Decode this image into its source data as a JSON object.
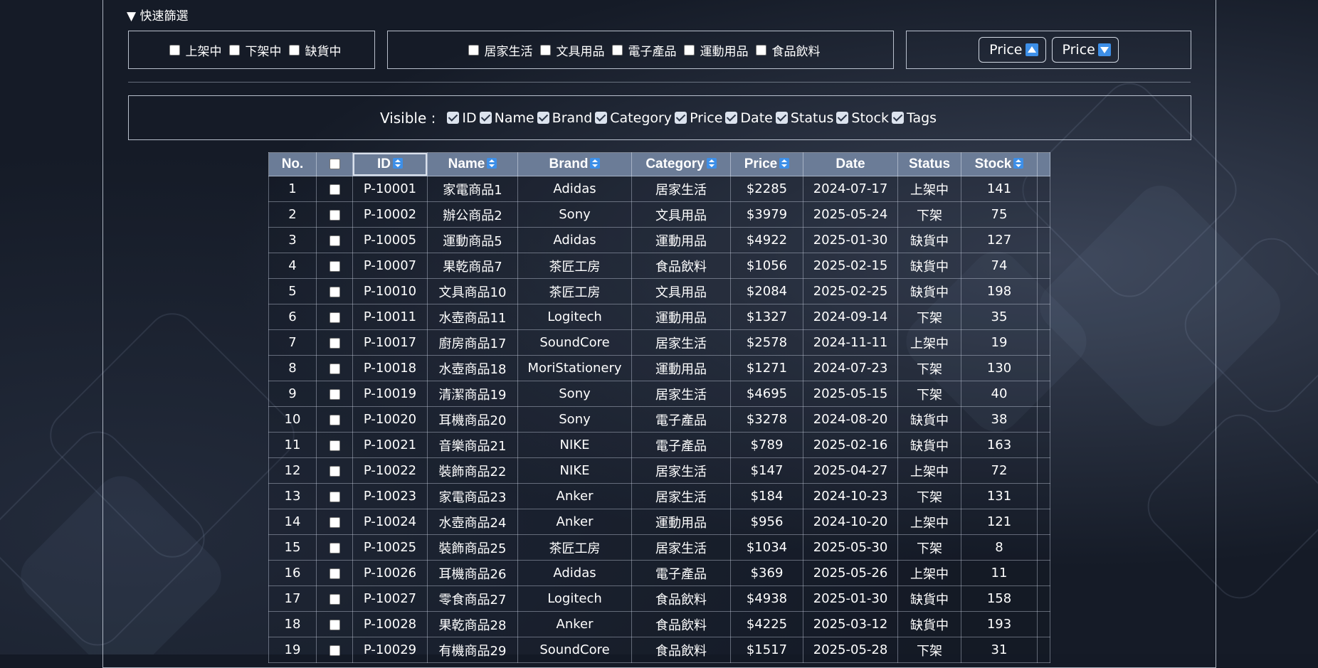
{
  "filters": {
    "toggle_label": "▼ 快速篩選",
    "status_options": [
      "上架中",
      "下架中",
      "缺貨中"
    ],
    "category_options": [
      "居家生活",
      "文具用品",
      "電子產品",
      "運動用品",
      "食品飲料"
    ],
    "sort_buttons": [
      {
        "label": "Price",
        "icon": "arrow-up-icon"
      },
      {
        "label": "Price",
        "icon": "arrow-down-icon"
      }
    ]
  },
  "visibility": {
    "label": "Visible :",
    "columns": [
      "ID",
      "Name",
      "Brand",
      "Category",
      "Price",
      "Date",
      "Status",
      "Stock",
      "Tags"
    ]
  },
  "table": {
    "headers": {
      "no": "No.",
      "id": "ID",
      "name": "Name",
      "brand": "Brand",
      "category": "Category",
      "price": "Price",
      "date": "Date",
      "status": "Status",
      "stock": "Stock"
    },
    "rows": [
      {
        "no": "1",
        "id": "P-10001",
        "name": "家電商品1",
        "brand": "Adidas",
        "category": "居家生活",
        "price": "$2285",
        "date": "2024-07-17",
        "status": "上架中",
        "stock": "141"
      },
      {
        "no": "2",
        "id": "P-10002",
        "name": "辦公商品2",
        "brand": "Sony",
        "category": "文具用品",
        "price": "$3979",
        "date": "2025-05-24",
        "status": "下架",
        "stock": "75"
      },
      {
        "no": "3",
        "id": "P-10005",
        "name": "運動商品5",
        "brand": "Adidas",
        "category": "運動用品",
        "price": "$4922",
        "date": "2025-01-30",
        "status": "缺貨中",
        "stock": "127"
      },
      {
        "no": "4",
        "id": "P-10007",
        "name": "果乾商品7",
        "brand": "茶匠工房",
        "category": "食品飲料",
        "price": "$1056",
        "date": "2025-02-15",
        "status": "缺貨中",
        "stock": "74"
      },
      {
        "no": "5",
        "id": "P-10010",
        "name": "文具商品10",
        "brand": "茶匠工房",
        "category": "文具用品",
        "price": "$2084",
        "date": "2025-02-25",
        "status": "缺貨中",
        "stock": "198"
      },
      {
        "no": "6",
        "id": "P-10011",
        "name": "水壺商品11",
        "brand": "Logitech",
        "category": "運動用品",
        "price": "$1327",
        "date": "2024-09-14",
        "status": "下架",
        "stock": "35"
      },
      {
        "no": "7",
        "id": "P-10017",
        "name": "廚房商品17",
        "brand": "SoundCore",
        "category": "居家生活",
        "price": "$2578",
        "date": "2024-11-11",
        "status": "上架中",
        "stock": "19"
      },
      {
        "no": "8",
        "id": "P-10018",
        "name": "水壺商品18",
        "brand": "MoriStationery",
        "category": "運動用品",
        "price": "$1271",
        "date": "2024-07-23",
        "status": "下架",
        "stock": "130"
      },
      {
        "no": "9",
        "id": "P-10019",
        "name": "清潔商品19",
        "brand": "Sony",
        "category": "居家生活",
        "price": "$4695",
        "date": "2025-05-15",
        "status": "下架",
        "stock": "40"
      },
      {
        "no": "10",
        "id": "P-10020",
        "name": "耳機商品20",
        "brand": "Sony",
        "category": "電子產品",
        "price": "$3278",
        "date": "2024-08-20",
        "status": "缺貨中",
        "stock": "38"
      },
      {
        "no": "11",
        "id": "P-10021",
        "name": "音樂商品21",
        "brand": "NIKE",
        "category": "電子產品",
        "price": "$789",
        "date": "2025-02-16",
        "status": "缺貨中",
        "stock": "163"
      },
      {
        "no": "12",
        "id": "P-10022",
        "name": "裝飾商品22",
        "brand": "NIKE",
        "category": "居家生活",
        "price": "$147",
        "date": "2025-04-27",
        "status": "上架中",
        "stock": "72"
      },
      {
        "no": "13",
        "id": "P-10023",
        "name": "家電商品23",
        "brand": "Anker",
        "category": "居家生活",
        "price": "$184",
        "date": "2024-10-23",
        "status": "下架",
        "stock": "131"
      },
      {
        "no": "14",
        "id": "P-10024",
        "name": "水壺商品24",
        "brand": "Anker",
        "category": "運動用品",
        "price": "$956",
        "date": "2024-10-20",
        "status": "上架中",
        "stock": "121"
      },
      {
        "no": "15",
        "id": "P-10025",
        "name": "裝飾商品25",
        "brand": "茶匠工房",
        "category": "居家生活",
        "price": "$1034",
        "date": "2025-05-30",
        "status": "下架",
        "stock": "8"
      },
      {
        "no": "16",
        "id": "P-10026",
        "name": "耳機商品26",
        "brand": "Adidas",
        "category": "電子產品",
        "price": "$369",
        "date": "2025-05-26",
        "status": "上架中",
        "stock": "11"
      },
      {
        "no": "17",
        "id": "P-10027",
        "name": "零食商品27",
        "brand": "Logitech",
        "category": "食品飲料",
        "price": "$4938",
        "date": "2025-01-30",
        "status": "缺貨中",
        "stock": "158"
      },
      {
        "no": "18",
        "id": "P-10028",
        "name": "果乾商品28",
        "brand": "Anker",
        "category": "食品飲料",
        "price": "$4225",
        "date": "2025-03-12",
        "status": "缺貨中",
        "stock": "193"
      },
      {
        "no": "19",
        "id": "P-10029",
        "name": "有機商品29",
        "brand": "SoundCore",
        "category": "食品飲料",
        "price": "$1517",
        "date": "2025-05-28",
        "status": "下架",
        "stock": "31"
      }
    ]
  },
  "colors": {
    "background": "#141a26",
    "table_header": "#6b7c97",
    "sort_icon": "#3d8fe8",
    "text": "#ffffff"
  }
}
